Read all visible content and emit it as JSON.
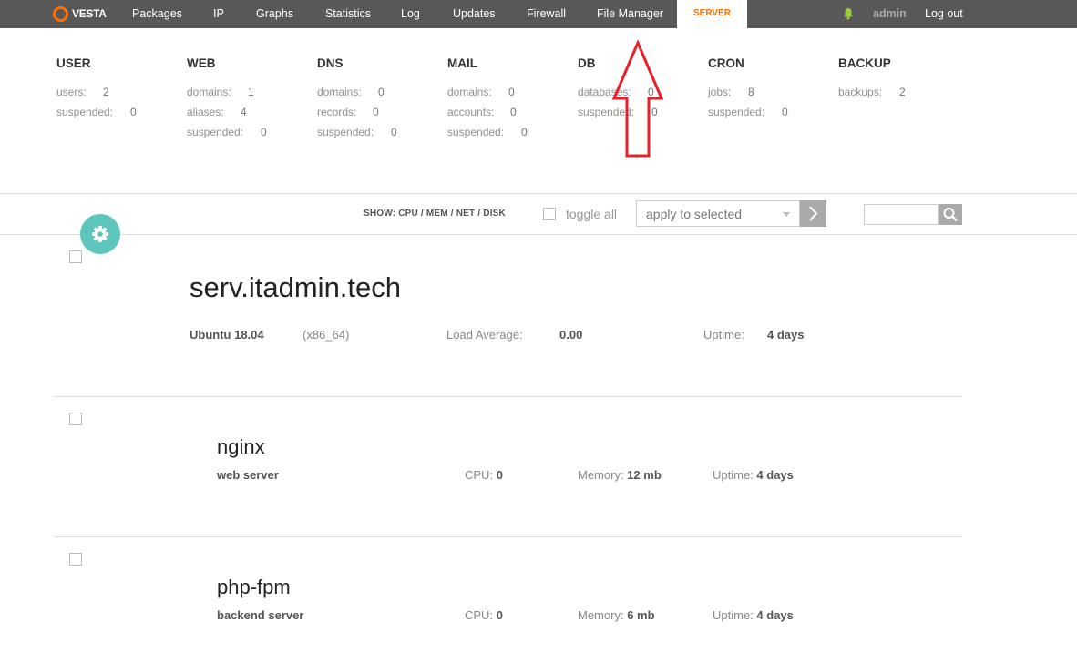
{
  "nav": {
    "logo": "VESTA",
    "items": [
      "Packages",
      "IP",
      "Graphs",
      "Statistics",
      "Log",
      "Updates",
      "Firewall",
      "File Manager"
    ],
    "active": "SERVER",
    "user": "admin",
    "logout": "Log out"
  },
  "stats": [
    {
      "title": "USER",
      "rows": [
        {
          "label": "users:",
          "value": "2"
        },
        {
          "label": "suspended:",
          "value": "0"
        }
      ]
    },
    {
      "title": "WEB",
      "rows": [
        {
          "label": "domains:",
          "value": "1"
        },
        {
          "label": "aliases:",
          "value": "4"
        },
        {
          "label": "suspended:",
          "value": "0"
        }
      ]
    },
    {
      "title": "DNS",
      "rows": [
        {
          "label": "domains:",
          "value": "0"
        },
        {
          "label": "records:",
          "value": "0"
        },
        {
          "label": "suspended:",
          "value": "0"
        }
      ]
    },
    {
      "title": "MAIL",
      "rows": [
        {
          "label": "domains:",
          "value": "0"
        },
        {
          "label": "accounts:",
          "value": "0"
        },
        {
          "label": "suspended:",
          "value": "0"
        }
      ]
    },
    {
      "title": "DB",
      "rows": [
        {
          "label": "databases:",
          "value": "0"
        },
        {
          "label": "suspended:",
          "value": "0"
        }
      ]
    },
    {
      "title": "CRON",
      "rows": [
        {
          "label": "jobs:",
          "value": "8"
        },
        {
          "label": "suspended:",
          "value": "0"
        }
      ]
    },
    {
      "title": "BACKUP",
      "rows": [
        {
          "label": "backups:",
          "value": "2"
        }
      ]
    }
  ],
  "toolbar": {
    "show_label": "SHOW: CPU / MEM / NET / DISK",
    "toggle_all": "toggle all",
    "apply_placeholder": "apply to selected"
  },
  "host": {
    "name": "serv.itadmin.tech",
    "os": "Ubuntu 18.04",
    "arch": "(x86_64)",
    "load_label": "Load Average:",
    "load_value": "0.00",
    "uptime_label": "Uptime:",
    "uptime_value": "4 days"
  },
  "services": [
    {
      "name": "nginx",
      "desc": "web server",
      "cpu_label": "CPU:",
      "cpu": "0",
      "mem_label": "Memory:",
      "mem": "12 mb",
      "up_label": "Uptime:",
      "up": "4 days"
    },
    {
      "name": "php-fpm",
      "desc": "backend server",
      "cpu_label": "CPU:",
      "cpu": "0",
      "mem_label": "Memory:",
      "mem": "6 mb",
      "up_label": "Uptime:",
      "up": "4 days"
    }
  ],
  "colors": {
    "accent": "#ff6e00",
    "topbar": "#585858",
    "gear": "#5cc5bc",
    "annotation_arrow": "#e8202a"
  },
  "icons": {
    "logo": "vesta-logo-icon",
    "bell": "bell-icon",
    "gear": "gear-icon",
    "search": "search-icon",
    "apply": "chevron-right-icon",
    "arrow": "up-arrow-annotation-icon"
  }
}
